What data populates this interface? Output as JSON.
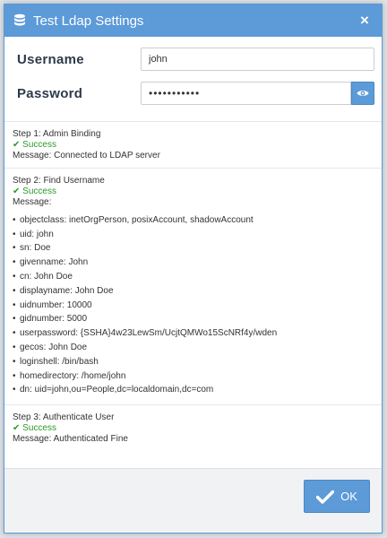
{
  "dialog": {
    "title": "Test Ldap Settings",
    "title_icon": "database-icon",
    "close_icon": "close-icon",
    "close_glyph": "×"
  },
  "form": {
    "username_label": "Username",
    "username_value": "john",
    "password_label": "Password",
    "password_value": "•••••••••••",
    "reveal_icon": "eye-icon"
  },
  "steps": [
    {
      "title": "Step 1: Admin Binding",
      "status": "✔ Success",
      "message": "Message: Connected to LDAP server"
    },
    {
      "title": "Step 2: Find Username",
      "status": "✔ Success",
      "message": "Message:",
      "attributes": [
        "objectclass: inetOrgPerson, posixAccount, shadowAccount",
        "uid: john",
        "sn: Doe",
        "givenname: John",
        "cn: John Doe",
        "displayname: John Doe",
        "uidnumber: 10000",
        "gidnumber: 5000",
        "userpassword: {SSHA}4w23LewSm/UcjtQMWo15ScNRf4y/wden",
        "gecos: John Doe",
        "loginshell: /bin/bash",
        "homedirectory: /home/john",
        "dn: uid=john,ou=People,dc=localdomain,dc=com"
      ]
    },
    {
      "title": "Step 3: Authenticate User",
      "status": "✔ Success",
      "message": "Message: Authenticated Fine"
    }
  ],
  "footer": {
    "ok_label": "OK",
    "ok_icon": "check-icon"
  },
  "colors": {
    "accent": "#5c9ad8",
    "success": "#2a9a2a"
  }
}
